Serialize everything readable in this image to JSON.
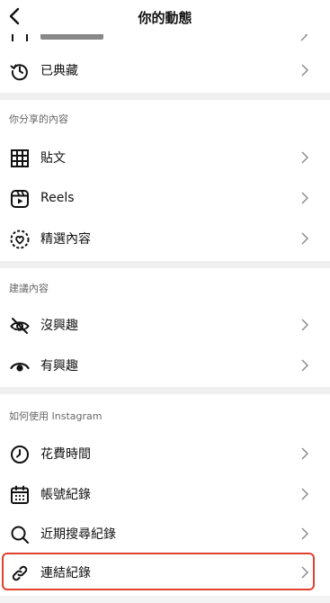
{
  "header": {
    "title": "你的動態"
  },
  "top_items": [
    {
      "label": "已典藏",
      "icon": "history-icon"
    }
  ],
  "sections": [
    {
      "title": "你分享的內容",
      "items": [
        {
          "label": "貼文",
          "icon": "grid-icon"
        },
        {
          "label": "Reels",
          "icon": "reels-icon"
        },
        {
          "label": "精選內容",
          "icon": "highlights-icon"
        }
      ]
    },
    {
      "title": "建議內容",
      "items": [
        {
          "label": "沒興趣",
          "icon": "eye-off-icon"
        },
        {
          "label": "有興趣",
          "icon": "eye-icon"
        }
      ]
    },
    {
      "title": "如何使用 Instagram",
      "items": [
        {
          "label": "花費時間",
          "icon": "clock-icon"
        },
        {
          "label": "帳號紀錄",
          "icon": "calendar-icon"
        },
        {
          "label": "近期搜尋紀錄",
          "icon": "search-icon"
        },
        {
          "label": "連結紀錄",
          "icon": "link-icon"
        }
      ]
    }
  ],
  "colors": {
    "highlight": "#e0402e",
    "separator": "#efefef",
    "chevron": "#8e8e8e"
  }
}
